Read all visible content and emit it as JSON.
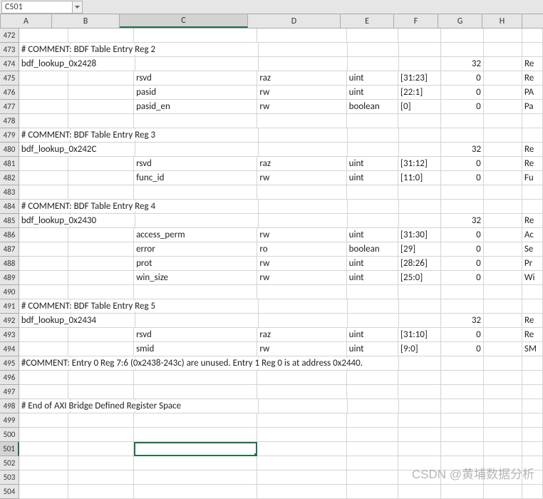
{
  "namebox": "C501",
  "columns": [
    "A",
    "B",
    "C",
    "D",
    "E",
    "F",
    "G",
    "H",
    ""
  ],
  "selected_col": "C",
  "selected_row": 501,
  "rows": [
    {
      "n": 472,
      "cells": [
        "",
        "",
        "",
        "",
        "",
        "",
        "",
        "",
        ""
      ]
    },
    {
      "n": 473,
      "cells": [
        "# COMMENT: BDF Table Entry Reg 2",
        "",
        "",
        "",
        "",
        "",
        "",
        "",
        ""
      ],
      "overflow": [
        0
      ]
    },
    {
      "n": 474,
      "cells": [
        "bdf_lookup_0x2428",
        "",
        "",
        "",
        "",
        "",
        "32",
        "",
        "Re"
      ],
      "overflow": [
        0
      ],
      "right": [
        6
      ]
    },
    {
      "n": 475,
      "cells": [
        "",
        "",
        "rsvd",
        "raz",
        "uint",
        "[31:23]",
        "0",
        "",
        "Re"
      ],
      "right": [
        6
      ]
    },
    {
      "n": 476,
      "cells": [
        "",
        "",
        "pasid",
        "rw",
        "uint",
        "[22:1]",
        "0",
        "",
        "PA"
      ],
      "right": [
        6
      ]
    },
    {
      "n": 477,
      "cells": [
        "",
        "",
        "pasid_en",
        "rw",
        "boolean",
        "[0]",
        "0",
        "",
        "Pa"
      ],
      "right": [
        6
      ]
    },
    {
      "n": 478,
      "cells": [
        "",
        "",
        "",
        "",
        "",
        "",
        "",
        "",
        ""
      ]
    },
    {
      "n": 479,
      "cells": [
        "# COMMENT: BDF Table Entry Reg 3",
        "",
        "",
        "",
        "",
        "",
        "",
        "",
        ""
      ],
      "overflow": [
        0
      ]
    },
    {
      "n": 480,
      "cells": [
        "bdf_lookup_0x242C",
        "",
        "",
        "",
        "",
        "",
        "32",
        "",
        "Re"
      ],
      "overflow": [
        0
      ],
      "right": [
        6
      ]
    },
    {
      "n": 481,
      "cells": [
        "",
        "",
        "rsvd",
        "raz",
        "uint",
        "[31:12]",
        "0",
        "",
        "Re"
      ],
      "right": [
        6
      ]
    },
    {
      "n": 482,
      "cells": [
        "",
        "",
        "func_id",
        "rw",
        "uint",
        "[11:0]",
        "0",
        "",
        "Fu"
      ],
      "right": [
        6
      ]
    },
    {
      "n": 483,
      "cells": [
        "",
        "",
        "",
        "",
        "",
        "",
        "",
        "",
        ""
      ]
    },
    {
      "n": 484,
      "cells": [
        "# COMMENT: BDF Table Entry Reg 4",
        "",
        "",
        "",
        "",
        "",
        "",
        "",
        ""
      ],
      "overflow": [
        0
      ]
    },
    {
      "n": 485,
      "cells": [
        "bdf_lookup_0x2430",
        "",
        "",
        "",
        "",
        "",
        "32",
        "",
        "Re"
      ],
      "overflow": [
        0
      ],
      "right": [
        6
      ]
    },
    {
      "n": 486,
      "cells": [
        "",
        "",
        "access_perm",
        "rw",
        "uint",
        "[31:30]",
        "0",
        "",
        "Ac"
      ],
      "right": [
        6
      ]
    },
    {
      "n": 487,
      "cells": [
        "",
        "",
        "error",
        "ro",
        "boolean",
        "[29]",
        "0",
        "",
        "Se"
      ],
      "right": [
        6
      ]
    },
    {
      "n": 488,
      "cells": [
        "",
        "",
        "prot",
        "rw",
        "uint",
        "[28:26]",
        "0",
        "",
        "Pr"
      ],
      "right": [
        6
      ]
    },
    {
      "n": 489,
      "cells": [
        "",
        "",
        "win_size",
        "rw",
        "uint",
        "[25:0]",
        "0",
        "",
        "Wi"
      ],
      "right": [
        6
      ]
    },
    {
      "n": 490,
      "cells": [
        "",
        "",
        "",
        "",
        "",
        "",
        "",
        "",
        ""
      ]
    },
    {
      "n": 491,
      "cells": [
        "# COMMENT: BDF Table Entry Reg 5",
        "",
        "",
        "",
        "",
        "",
        "",
        "",
        ""
      ],
      "overflow": [
        0
      ]
    },
    {
      "n": 492,
      "cells": [
        "bdf_lookup_0x2434",
        "",
        "",
        "",
        "",
        "",
        "32",
        "",
        "Re"
      ],
      "overflow": [
        0
      ],
      "right": [
        6
      ]
    },
    {
      "n": 493,
      "cells": [
        "",
        "",
        "rsvd",
        "raz",
        "uint",
        "[31:10]",
        "0",
        "",
        "Re"
      ],
      "right": [
        6
      ]
    },
    {
      "n": 494,
      "cells": [
        "",
        "",
        "smid",
        "rw",
        "uint",
        "[9:0]",
        "0",
        "",
        "SM"
      ],
      "right": [
        6
      ]
    },
    {
      "n": 495,
      "cells": [
        "#COMMENT: Entry 0 Reg 7:6 (0x2438-243c) are unused. Entry 1 Reg 0 is at address 0x2440.",
        "",
        "",
        "",
        "",
        "",
        "",
        "",
        ""
      ],
      "overflow": [
        0
      ]
    },
    {
      "n": 496,
      "cells": [
        "",
        "",
        "",
        "",
        "",
        "",
        "",
        "",
        ""
      ]
    },
    {
      "n": 497,
      "cells": [
        "",
        "",
        "",
        "",
        "",
        "",
        "",
        "",
        ""
      ]
    },
    {
      "n": 498,
      "cells": [
        "# End of AXI Bridge Defined Register Space",
        "",
        "",
        "",
        "",
        "",
        "",
        "",
        ""
      ],
      "overflow": [
        0
      ]
    },
    {
      "n": 499,
      "cells": [
        "",
        "",
        "",
        "",
        "",
        "",
        "",
        "",
        ""
      ]
    },
    {
      "n": 500,
      "cells": [
        "",
        "",
        "",
        "",
        "",
        "",
        "",
        "",
        ""
      ]
    },
    {
      "n": 501,
      "cells": [
        "",
        "",
        "",
        "",
        "",
        "",
        "",
        "",
        ""
      ]
    },
    {
      "n": 502,
      "cells": [
        "",
        "",
        "",
        "",
        "",
        "",
        "",
        "",
        ""
      ]
    },
    {
      "n": 503,
      "cells": [
        "",
        "",
        "",
        "",
        "",
        "",
        "",
        "",
        ""
      ]
    },
    {
      "n": 504,
      "cells": [
        "",
        "",
        "",
        "",
        "",
        "",
        "",
        "",
        ""
      ]
    }
  ],
  "watermark": "CSDN @黄埔数据分析"
}
